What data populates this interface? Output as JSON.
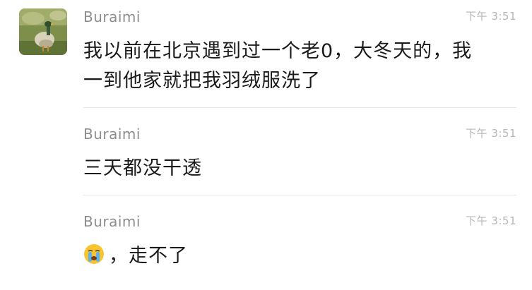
{
  "messages": [
    {
      "sender": "Buraimi",
      "time": "下午 3:51",
      "line1": "我以前在北京遇到过一个老0，大冬天的，我",
      "line2": "一到他家就把我羽绒服洗了"
    },
    {
      "sender": "Buraimi",
      "time": "下午 3:51",
      "text": "三天都没干透"
    },
    {
      "sender": "Buraimi",
      "time": "下午 3:51",
      "emoji": "crying-face-icon",
      "text": "，走不了"
    }
  ],
  "colors": {
    "sender": "#8d8d8d",
    "time": "#b6b6b6",
    "text": "#1a1a1a",
    "divider": "#e6e6e6"
  }
}
